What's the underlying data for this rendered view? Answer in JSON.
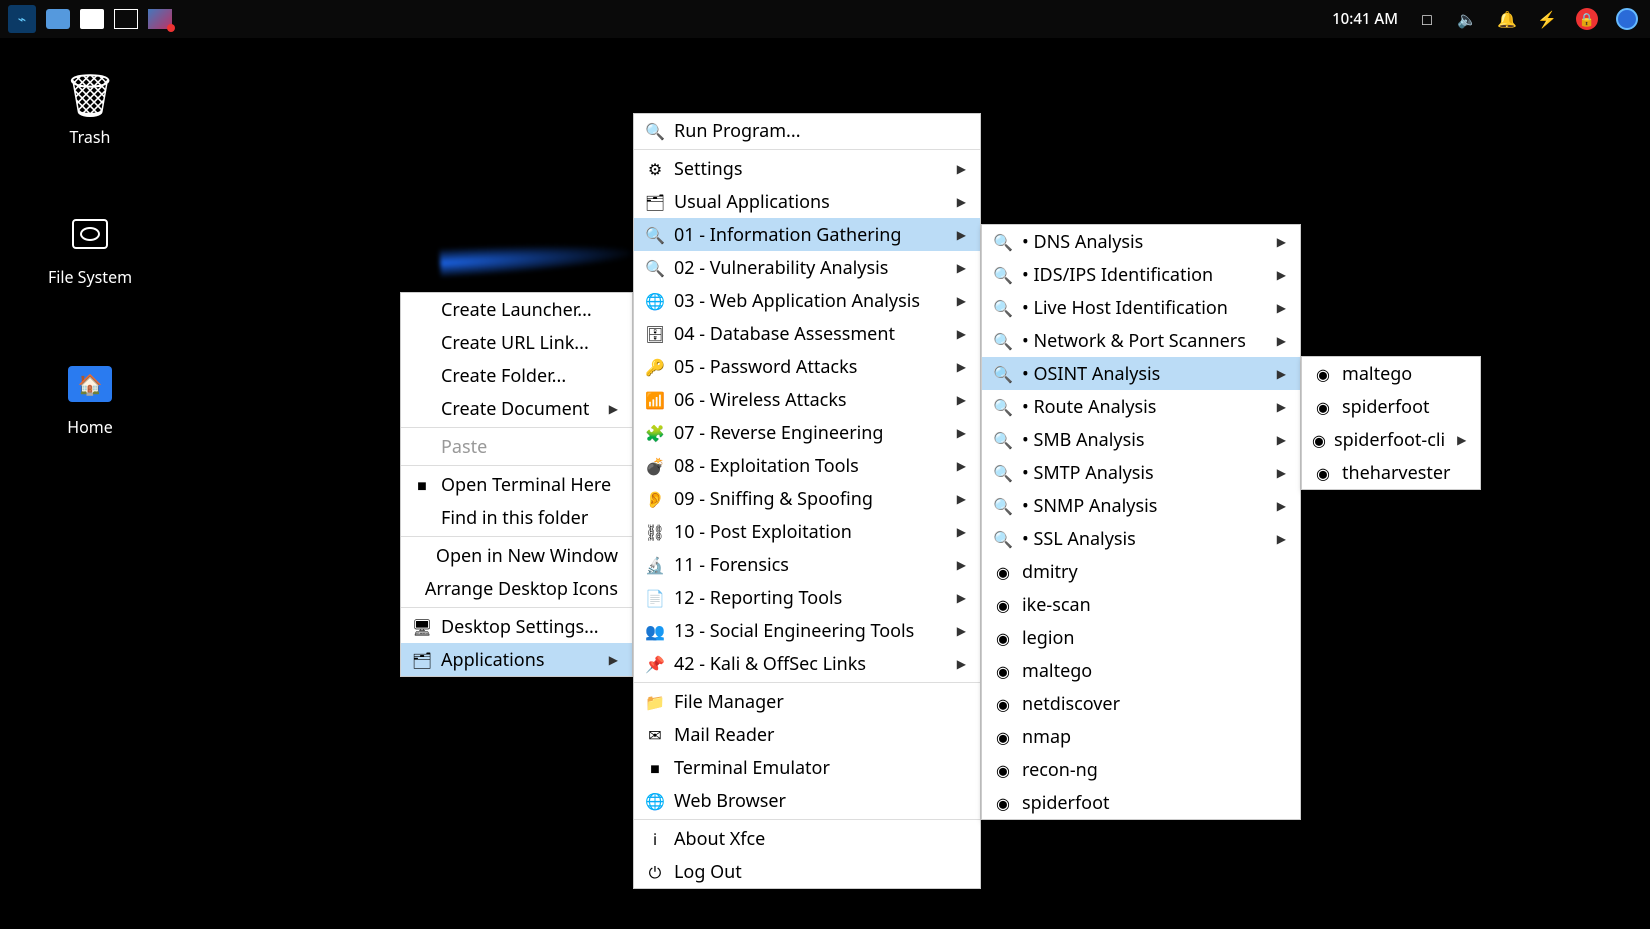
{
  "panel": {
    "clock": "10:41 AM"
  },
  "desktop": {
    "trash": "Trash",
    "filesystem": "File System",
    "home": "Home"
  },
  "menu1": {
    "items": [
      {
        "label": "Create Launcher...",
        "icon": "",
        "arrow": false
      },
      {
        "label": "Create URL Link...",
        "icon": "",
        "arrow": false
      },
      {
        "label": "Create Folder...",
        "icon": "",
        "arrow": false
      },
      {
        "label": "Create Document",
        "icon": "",
        "arrow": true
      },
      {
        "label": "Paste",
        "icon": "",
        "arrow": false,
        "disabled": true
      },
      {
        "label": "Open Terminal Here",
        "icon": "■",
        "arrow": false
      },
      {
        "label": "Find in this folder",
        "icon": "",
        "arrow": false
      },
      {
        "label": "Open in New Window",
        "icon": "",
        "arrow": false
      },
      {
        "label": "Arrange Desktop Icons",
        "icon": "",
        "arrow": false
      },
      {
        "label": "Desktop Settings...",
        "icon": "🖥",
        "arrow": false
      },
      {
        "label": "Applications",
        "icon": "🗂",
        "arrow": true,
        "highlight": true
      }
    ]
  },
  "menu2": {
    "items": [
      {
        "label": "Run Program...",
        "icon": "🔍"
      },
      {
        "label": "Settings",
        "icon": "⚙",
        "arrow": true,
        "sepBefore": true
      },
      {
        "label": "Usual Applications",
        "icon": "🗂",
        "arrow": true
      },
      {
        "label": "01 - Information Gathering",
        "icon": "🔍",
        "arrow": true,
        "highlight": true
      },
      {
        "label": "02 - Vulnerability Analysis",
        "icon": "🔍",
        "arrow": true
      },
      {
        "label": "03 - Web Application Analysis",
        "icon": "🌐",
        "arrow": true
      },
      {
        "label": "04 - Database Assessment",
        "icon": "🗄",
        "arrow": true
      },
      {
        "label": "05 - Password Attacks",
        "icon": "🔑",
        "arrow": true
      },
      {
        "label": "06 - Wireless Attacks",
        "icon": "📶",
        "arrow": true
      },
      {
        "label": "07 - Reverse Engineering",
        "icon": "🧩",
        "arrow": true
      },
      {
        "label": "08 - Exploitation Tools",
        "icon": "💣",
        "arrow": true
      },
      {
        "label": "09 - Sniffing & Spoofing",
        "icon": "👂",
        "arrow": true
      },
      {
        "label": "10 - Post Exploitation",
        "icon": "⛓",
        "arrow": true
      },
      {
        "label": "11 - Forensics",
        "icon": "🔬",
        "arrow": true
      },
      {
        "label": "12 - Reporting Tools",
        "icon": "📄",
        "arrow": true
      },
      {
        "label": "13 - Social Engineering Tools",
        "icon": "👥",
        "arrow": true
      },
      {
        "label": "42 - Kali & OffSec Links",
        "icon": "📌",
        "arrow": true
      },
      {
        "label": "File Manager",
        "icon": "📁",
        "sepBefore": true
      },
      {
        "label": "Mail Reader",
        "icon": "✉"
      },
      {
        "label": "Terminal Emulator",
        "icon": "■"
      },
      {
        "label": "Web Browser",
        "icon": "🌐"
      },
      {
        "label": "About Xfce",
        "icon": "ℹ",
        "sepBefore": true
      },
      {
        "label": "Log Out",
        "icon": "⏻"
      }
    ]
  },
  "menu3": {
    "items": [
      {
        "label": "• DNS Analysis",
        "icon": "🔍",
        "arrow": true
      },
      {
        "label": "• IDS/IPS Identification",
        "icon": "🔍",
        "arrow": true
      },
      {
        "label": "• Live Host Identification",
        "icon": "🔍",
        "arrow": true
      },
      {
        "label": "• Network & Port Scanners",
        "icon": "🔍",
        "arrow": true
      },
      {
        "label": "• OSINT Analysis",
        "icon": "🔍",
        "arrow": true,
        "highlight": true
      },
      {
        "label": "• Route Analysis",
        "icon": "🔍",
        "arrow": true
      },
      {
        "label": "• SMB Analysis",
        "icon": "🔍",
        "arrow": true
      },
      {
        "label": "• SMTP Analysis",
        "icon": "🔍",
        "arrow": true
      },
      {
        "label": "• SNMP Analysis",
        "icon": "🔍",
        "arrow": true
      },
      {
        "label": "• SSL Analysis",
        "icon": "🔍",
        "arrow": true
      },
      {
        "label": "dmitry",
        "icon": "◉"
      },
      {
        "label": "ike-scan",
        "icon": "◉"
      },
      {
        "label": "legion",
        "icon": "◉"
      },
      {
        "label": "maltego",
        "icon": "◉"
      },
      {
        "label": "netdiscover",
        "icon": "◉"
      },
      {
        "label": "nmap",
        "icon": "◉"
      },
      {
        "label": "recon-ng",
        "icon": "◉"
      },
      {
        "label": "spiderfoot",
        "icon": "◉"
      }
    ]
  },
  "menu4": {
    "items": [
      {
        "label": "maltego",
        "icon": "◉"
      },
      {
        "label": "spiderfoot",
        "icon": "◉"
      },
      {
        "label": "spiderfoot-cli",
        "icon": "◉",
        "arrow": true
      },
      {
        "label": "theharvester",
        "icon": "◉"
      }
    ]
  }
}
